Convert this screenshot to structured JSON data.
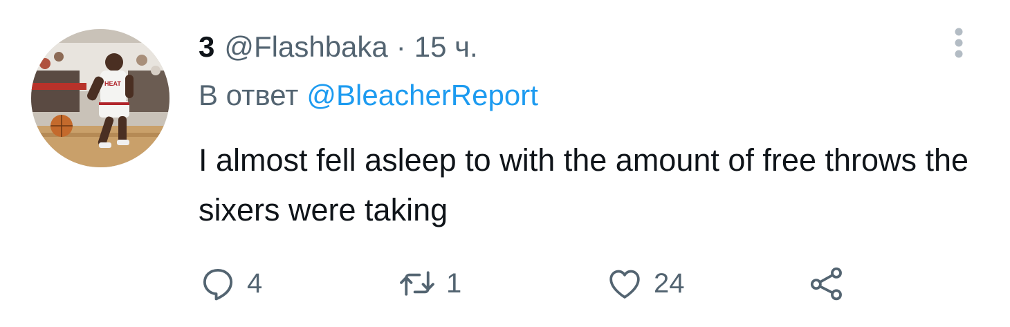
{
  "tweet": {
    "display_name": "3",
    "handle": "@Flashbaka",
    "separator": "·",
    "time": "15 ч.",
    "reply_prefix": "В ответ",
    "reply_mention": "@BleacherReport",
    "text": "I almost fell asleep to with the amount of free throws the sixers were taking"
  },
  "actions": {
    "reply": {
      "icon": "reply-bubble-icon",
      "count": "4"
    },
    "retweet": {
      "icon": "retweet-icon",
      "count": "1"
    },
    "like": {
      "icon": "heart-icon",
      "count": "24"
    },
    "share": {
      "icon": "share-icon"
    }
  },
  "colors": {
    "text_primary": "#0f1419",
    "text_secondary": "#536471",
    "accent": "#1d9bf0"
  }
}
